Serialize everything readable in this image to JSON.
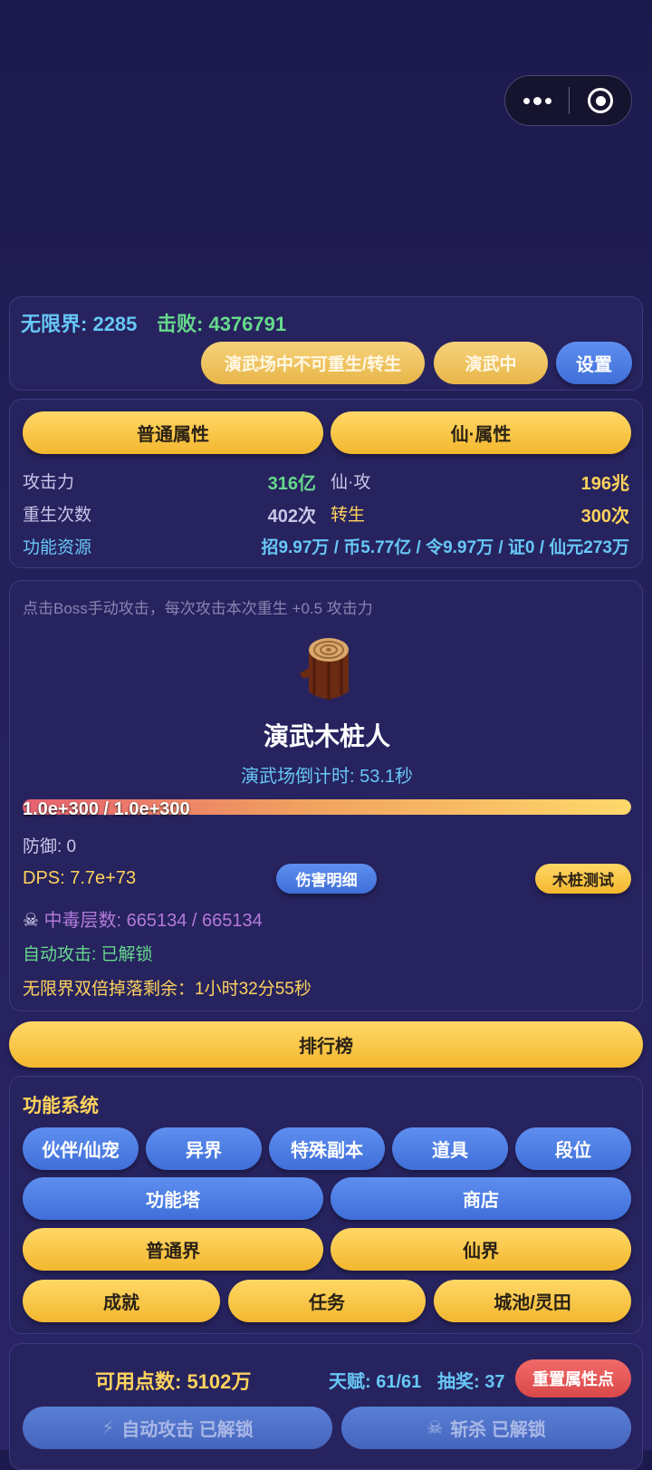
{
  "capsule": {
    "more_icon": "more-dots-icon",
    "close_icon": "target-circle-icon"
  },
  "stats_bar": {
    "realm_label": "无限界:",
    "realm_value": "2285",
    "defeat_label": "击败:",
    "defeat_value": "4376791",
    "btn_rebirth": "演武场中不可重生/转生",
    "btn_training": "演武中",
    "btn_settings": "设置"
  },
  "attributes": {
    "tab_normal": "普通属性",
    "tab_immortal": "仙·属性",
    "attack_label": "攻击力",
    "attack_value": "316亿",
    "immortal_attack_label": "仙·攻",
    "immortal_attack_value": "196兆",
    "rebirth_label": "重生次数",
    "rebirth_value": "402次",
    "reincarnation_label": "转生",
    "reincarnation_value": "300次",
    "resources_label": "功能资源",
    "resources_value": "招9.97万 / 币5.77亿 / 令9.97万 / 证0 / 仙元273万"
  },
  "boss": {
    "hint": "点击Boss手动攻击，每次攻击本次重生 +0.5 攻击力",
    "name": "演武木桩人",
    "countdown": "演武场倒计时: 53.1秒",
    "hp_text": "1.0e+300 / 1.0e+300",
    "hp_fraction": 1.0,
    "defense": "防御: 0",
    "dps": "DPS: 7.7e+73",
    "btn_damage_detail": "伤害明细",
    "btn_stump_test": "木桩测试",
    "poison": "中毒层数: 665134 / 665134",
    "auto_attack": "自动攻击: 已解锁",
    "double_drop": "无限界双倍掉落剩余：1小时32分55秒"
  },
  "leaderboard": "排行榜",
  "functions": {
    "title": "功能系统",
    "row1": [
      "伙伴/仙宠",
      "异界",
      "特殊副本",
      "道具",
      "段位"
    ],
    "row2": [
      "功能塔",
      "商店"
    ],
    "row3": [
      "普通界",
      "仙界"
    ],
    "row4": [
      "成就",
      "任务",
      "城池/灵田"
    ]
  },
  "bottom": {
    "points": "可用点数: 5102万",
    "talent": "天赋: 61/61",
    "lottery": "抽奖: 37",
    "btn_reset": "重置属性点",
    "btn_auto_attack": "自动攻击 已解锁",
    "btn_kill": "斩杀 已解锁"
  },
  "colors": {
    "cyan": "#67c7f5",
    "green": "#66d98c",
    "gold": "#ffd35c",
    "purple": "#b27ad9",
    "bg": "#1c1a4d"
  }
}
